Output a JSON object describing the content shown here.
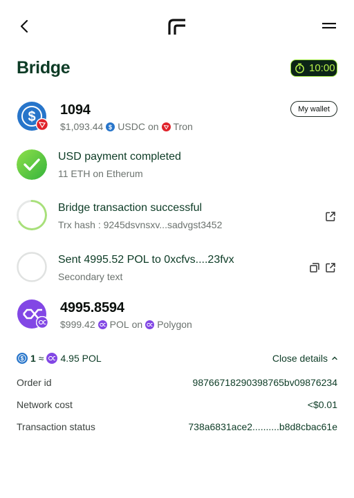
{
  "header": {
    "title": "Bridge",
    "timer": "10:00"
  },
  "source": {
    "amount": "1094",
    "fiat": "$1,093.44",
    "token": "USDC",
    "on_label": "on",
    "chain": "Tron",
    "wallet_button": "My wallet"
  },
  "steps": [
    {
      "title": "USD payment completed",
      "subtitle": "11 ETH on Etherum",
      "status": "completed"
    },
    {
      "title": "Bridge transaction successful",
      "subtitle": "Trx hash : 9245dsvnsxv...sadvgst3452",
      "status": "in-progress"
    },
    {
      "title": "Sent 4995.52 POL to 0xcfvs....23fvx",
      "subtitle": "Secondary text",
      "status": "pending"
    }
  ],
  "destination": {
    "amount": "4995.8594",
    "fiat": "$999.42",
    "token": "POL",
    "on_label": "on",
    "chain": "Polygon"
  },
  "rate": {
    "left": "1",
    "approx": "≈",
    "right": "4.95 POL"
  },
  "details": {
    "toggle_label": "Close details",
    "rows": [
      {
        "label": "Order id",
        "value": "98766718290398765bv09876234"
      },
      {
        "label": "Network cost",
        "value": "<$0.01"
      },
      {
        "label": "Transaction status",
        "value": "738a6831ace2..........b8d8cbac61e"
      }
    ]
  },
  "colors": {
    "usdc": "#2775ca",
    "tron": "#e0232b",
    "polygon": "#8247e5",
    "success": "#5cc93a",
    "accent": "#0c3b25"
  }
}
